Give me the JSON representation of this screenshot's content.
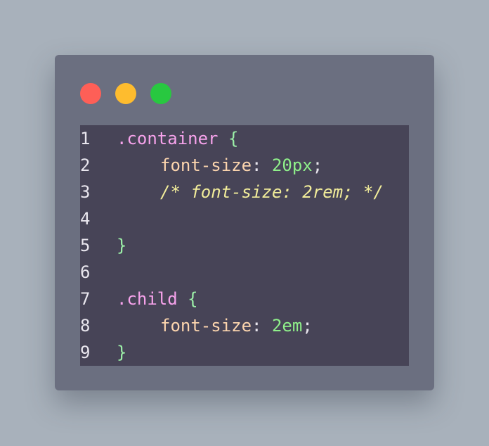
{
  "window": {
    "buttons": {
      "close_color": "#fe5f57",
      "minimize_color": "#febc2e",
      "maximize_color": "#28c840"
    }
  },
  "colors": {
    "line_number": "#e9e6ee",
    "selector": "#f7a3ec",
    "brace": "#9cf0a8",
    "property": "#fcd5ae",
    "punct": "#e9e6ee",
    "value": "#8ff08a",
    "comment": "#f2ed9a"
  },
  "code": {
    "lines": [
      {
        "n": "1",
        "selector": ".container",
        "brace": "{"
      },
      {
        "n": "2",
        "property": "font-size",
        "colon": ":",
        "value": "20px",
        "semi": ";"
      },
      {
        "n": "3",
        "comment": "/* font-size: 2rem; */"
      },
      {
        "n": "4"
      },
      {
        "n": "5",
        "brace": "}"
      },
      {
        "n": "6"
      },
      {
        "n": "7",
        "selector": ".child",
        "brace": "{"
      },
      {
        "n": "8",
        "property": "font-size",
        "colon": ":",
        "value": "2em",
        "semi": ";"
      },
      {
        "n": "9",
        "brace": "}"
      }
    ]
  }
}
